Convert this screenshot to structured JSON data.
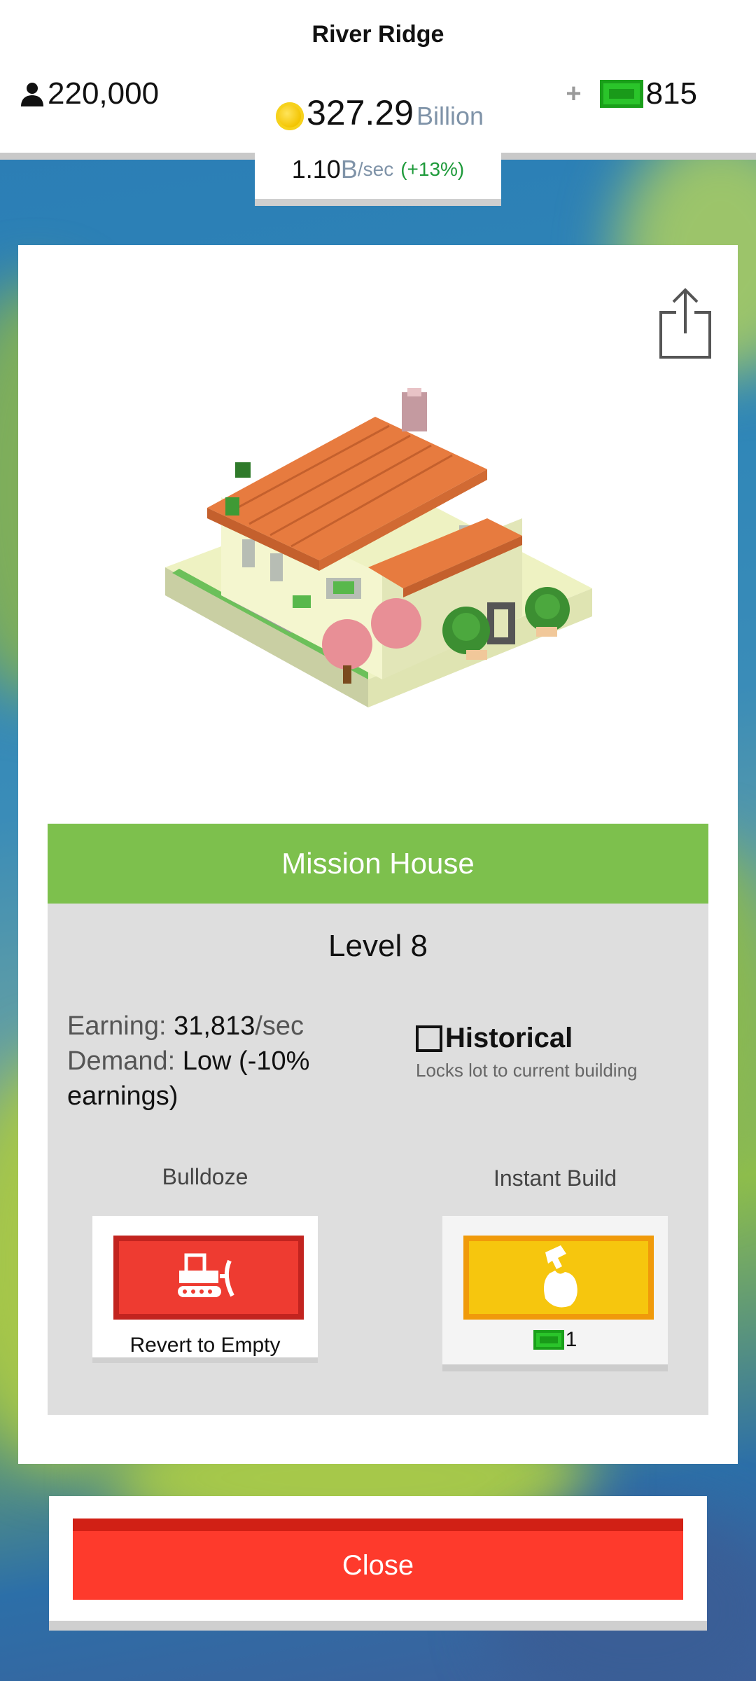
{
  "header": {
    "city_name": "River Ridge",
    "population": "220,000",
    "money_amount": "327.29",
    "money_unit": "Billion",
    "cash": "815",
    "plus_label": "+",
    "rate_value": "1.10",
    "rate_unit": "B",
    "rate_per": "/sec",
    "rate_change": "(+13%)"
  },
  "building": {
    "name": "Mission House",
    "level": "Level 8",
    "earning_key": "Earning:",
    "earning_value": "31,813",
    "earning_unit": "/sec",
    "demand_key": "Demand:",
    "demand_value": "Low (-10% earnings)",
    "historical_label": "Historical",
    "historical_checked": false,
    "historical_sub": "Locks lot to current building"
  },
  "actions": {
    "bulldoze_label": "Bulldoze",
    "bulldoze_caption": "Revert to Empty",
    "instant_build_label": "Instant Build",
    "instant_build_cost": "1"
  },
  "close_label": "Close",
  "icons": {
    "population": "person-icon",
    "money": "coin-icon",
    "cash": "cash-bill-icon",
    "share": "share-icon",
    "bulldozer": "bulldozer-icon",
    "hammer": "hammer-hand-icon"
  },
  "colors": {
    "title_bar": "#7dc04d",
    "bulldoze": "#ee3b31",
    "instant_build": "#f6c60e",
    "close": "#fe3a2c",
    "rate_change": "#1e9a3a"
  }
}
